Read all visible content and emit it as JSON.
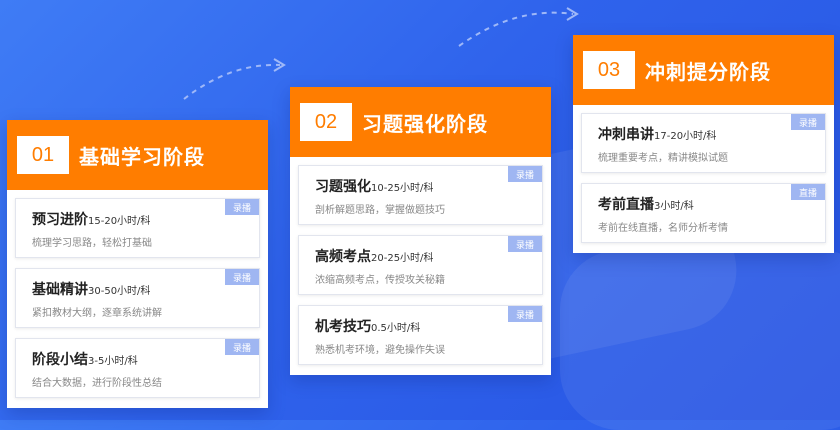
{
  "stages": [
    {
      "num": "01",
      "title": "基础学习阶段",
      "items": [
        {
          "title": "预习进阶",
          "hours": "15-20小时/科",
          "desc": "梳理学习思路，轻松打基础",
          "badge": "录播"
        },
        {
          "title": "基础精讲",
          "hours": "30-50小时/科",
          "desc": "紧扣教材大纲，逐章系统讲解",
          "badge": "录播"
        },
        {
          "title": "阶段小结",
          "hours": "3-5小时/科",
          "desc": "结合大数据，进行阶段性总结",
          "badge": "录播"
        }
      ]
    },
    {
      "num": "02",
      "title": "习题强化阶段",
      "items": [
        {
          "title": "习题强化",
          "hours": "10-25小时/科",
          "desc": "剖析解题思路，掌握做题技巧",
          "badge": "录播"
        },
        {
          "title": "高频考点",
          "hours": "20-25小时/科",
          "desc": "浓缩高频考点，传授攻关秘籍",
          "badge": "录播"
        },
        {
          "title": "机考技巧",
          "hours": "0.5小时/科",
          "desc": "熟悉机考环境，避免操作失误",
          "badge": "录播"
        }
      ]
    },
    {
      "num": "03",
      "title": "冲刺提分阶段",
      "items": [
        {
          "title": "冲刺串讲",
          "hours": "17-20小时/科",
          "desc": "梳理重要考点，精讲模拟试题",
          "badge": "录播"
        },
        {
          "title": "考前直播",
          "hours": "3小时/科",
          "desc": "考前在线直播，名师分析考情",
          "badge": "直播"
        }
      ]
    }
  ],
  "colors": {
    "accent": "#ff7d00",
    "background": "#3064ec",
    "badge": "#9fb6f2"
  }
}
